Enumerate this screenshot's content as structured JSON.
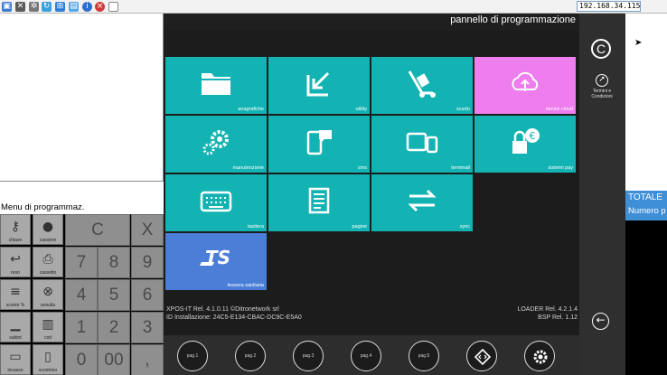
{
  "toolbar": {
    "ip_address": "192.168.34.115"
  },
  "left": {
    "menu_label": "Menu di programmaz."
  },
  "function_buttons": [
    {
      "icon": "key-icon",
      "label": "chiave"
    },
    {
      "icon": "cashier-icon",
      "label": "cassiere"
    },
    {
      "icon": "back-arrow-icon",
      "label": "reso"
    },
    {
      "icon": "printer-icon",
      "label": "cassetto"
    },
    {
      "icon": "discount-icon",
      "label": "sconto %"
    },
    {
      "icon": "cancel-icon",
      "label": "annulla"
    },
    {
      "icon": "sub-icon",
      "label": "subtot"
    },
    {
      "icon": "barcode-icon",
      "label": "cod"
    },
    {
      "icon": "pay-icon",
      "label": "incasso"
    },
    {
      "icon": "receipt-icon",
      "label": "scontrino"
    }
  ],
  "keypad": {
    "keys": [
      "C",
      "X",
      "7",
      "8",
      "9",
      "4",
      "5",
      "6",
      "1",
      "2",
      "3",
      "0",
      "00",
      ","
    ]
  },
  "main": {
    "title": "pannello di  programmazione",
    "tiles": [
      {
        "label": "anagrafiche",
        "icon": "folder-icon",
        "color": "#14b3b3"
      },
      {
        "label": "utility",
        "icon": "import-arrow-icon",
        "color": "#14b3b3"
      },
      {
        "label": "scarto",
        "icon": "trolley-icon",
        "color": "#14b3b3"
      },
      {
        "label": "servizi cloud",
        "icon": "cloud-icon",
        "color": "#ee7ded"
      },
      {
        "label": "manutenzione",
        "icon": "gears-icon",
        "color": "#14b3b3"
      },
      {
        "label": "sms",
        "icon": "phone-chat-icon",
        "color": "#14b3b3"
      },
      {
        "label": "terminali",
        "icon": "devices-icon",
        "color": "#14b3b3"
      },
      {
        "label": "sistemi pay",
        "icon": "euro-lock-icon",
        "color": "#14b3b3"
      },
      {
        "label": "tastiera",
        "icon": "keyboard-icon",
        "color": "#14b3b3"
      },
      {
        "label": "pagine",
        "icon": "pages-icon",
        "color": "#14b3b3"
      },
      {
        "label": "sync",
        "icon": "swap-arrows-icon",
        "color": "#14b3b3"
      },
      {
        "label": "tessera sanitaria",
        "icon": "ts-card-icon",
        "color": "#4b7fd7"
      }
    ],
    "info": {
      "version_line": "XPOS-IT Rel. 4.1.0.11   ©Ditronetwork srl",
      "install_id": "ID Installazione: 24C5-E134-CBAC-DC9C-E5A0",
      "loader": "LOADER Rel. 4.2.1.4",
      "bsp": "BSP Rel. 1.12"
    }
  },
  "bottom_bar": {
    "buttons": [
      {
        "label": "pag.1"
      },
      {
        "label": "pag.2"
      },
      {
        "label": "pag.3"
      },
      {
        "label": "pag.4"
      },
      {
        "label": "pag.5"
      }
    ],
    "icons": [
      "diamond-arrows-icon",
      "settings-gear-icon",
      "chart-icon"
    ]
  },
  "right_sidebar": {
    "top_glyph": "C",
    "terms_label": "Termini e Condizioni"
  },
  "totale": {
    "title": "TOTALE",
    "subtitle": "Numero p"
  }
}
